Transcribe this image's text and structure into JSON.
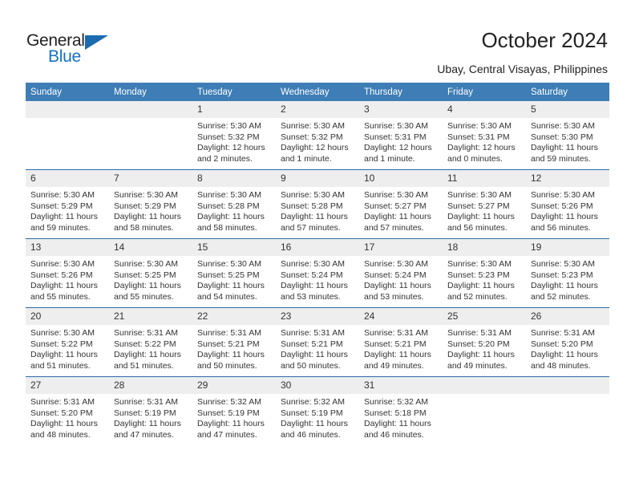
{
  "logo": {
    "word_one": "General",
    "word_two": "Blue",
    "triangle_color": "#1b6bb0",
    "blue_color": "#1472c4"
  },
  "header": {
    "title": "October 2024",
    "subtitle": "Ubay, Central Visayas, Philippines",
    "accent_color": "#3e7db5",
    "row_divider_color": "#2b6ca8",
    "daynum_band_color": "#eeeeee"
  },
  "calendar": {
    "weekday_headers": [
      "Sunday",
      "Monday",
      "Tuesday",
      "Wednesday",
      "Thursday",
      "Friday",
      "Saturday"
    ],
    "weeks": [
      [
        {
          "day": "",
          "sunrise": "",
          "sunset": "",
          "daylight": ""
        },
        {
          "day": "",
          "sunrise": "",
          "sunset": "",
          "daylight": ""
        },
        {
          "day": "1",
          "sunrise": "Sunrise: 5:30 AM",
          "sunset": "Sunset: 5:32 PM",
          "daylight": "Daylight: 12 hours and 2 minutes."
        },
        {
          "day": "2",
          "sunrise": "Sunrise: 5:30 AM",
          "sunset": "Sunset: 5:32 PM",
          "daylight": "Daylight: 12 hours and 1 minute."
        },
        {
          "day": "3",
          "sunrise": "Sunrise: 5:30 AM",
          "sunset": "Sunset: 5:31 PM",
          "daylight": "Daylight: 12 hours and 1 minute."
        },
        {
          "day": "4",
          "sunrise": "Sunrise: 5:30 AM",
          "sunset": "Sunset: 5:31 PM",
          "daylight": "Daylight: 12 hours and 0 minutes."
        },
        {
          "day": "5",
          "sunrise": "Sunrise: 5:30 AM",
          "sunset": "Sunset: 5:30 PM",
          "daylight": "Daylight: 11 hours and 59 minutes."
        }
      ],
      [
        {
          "day": "6",
          "sunrise": "Sunrise: 5:30 AM",
          "sunset": "Sunset: 5:29 PM",
          "daylight": "Daylight: 11 hours and 59 minutes."
        },
        {
          "day": "7",
          "sunrise": "Sunrise: 5:30 AM",
          "sunset": "Sunset: 5:29 PM",
          "daylight": "Daylight: 11 hours and 58 minutes."
        },
        {
          "day": "8",
          "sunrise": "Sunrise: 5:30 AM",
          "sunset": "Sunset: 5:28 PM",
          "daylight": "Daylight: 11 hours and 58 minutes."
        },
        {
          "day": "9",
          "sunrise": "Sunrise: 5:30 AM",
          "sunset": "Sunset: 5:28 PM",
          "daylight": "Daylight: 11 hours and 57 minutes."
        },
        {
          "day": "10",
          "sunrise": "Sunrise: 5:30 AM",
          "sunset": "Sunset: 5:27 PM",
          "daylight": "Daylight: 11 hours and 57 minutes."
        },
        {
          "day": "11",
          "sunrise": "Sunrise: 5:30 AM",
          "sunset": "Sunset: 5:27 PM",
          "daylight": "Daylight: 11 hours and 56 minutes."
        },
        {
          "day": "12",
          "sunrise": "Sunrise: 5:30 AM",
          "sunset": "Sunset: 5:26 PM",
          "daylight": "Daylight: 11 hours and 56 minutes."
        }
      ],
      [
        {
          "day": "13",
          "sunrise": "Sunrise: 5:30 AM",
          "sunset": "Sunset: 5:26 PM",
          "daylight": "Daylight: 11 hours and 55 minutes."
        },
        {
          "day": "14",
          "sunrise": "Sunrise: 5:30 AM",
          "sunset": "Sunset: 5:25 PM",
          "daylight": "Daylight: 11 hours and 55 minutes."
        },
        {
          "day": "15",
          "sunrise": "Sunrise: 5:30 AM",
          "sunset": "Sunset: 5:25 PM",
          "daylight": "Daylight: 11 hours and 54 minutes."
        },
        {
          "day": "16",
          "sunrise": "Sunrise: 5:30 AM",
          "sunset": "Sunset: 5:24 PM",
          "daylight": "Daylight: 11 hours and 53 minutes."
        },
        {
          "day": "17",
          "sunrise": "Sunrise: 5:30 AM",
          "sunset": "Sunset: 5:24 PM",
          "daylight": "Daylight: 11 hours and 53 minutes."
        },
        {
          "day": "18",
          "sunrise": "Sunrise: 5:30 AM",
          "sunset": "Sunset: 5:23 PM",
          "daylight": "Daylight: 11 hours and 52 minutes."
        },
        {
          "day": "19",
          "sunrise": "Sunrise: 5:30 AM",
          "sunset": "Sunset: 5:23 PM",
          "daylight": "Daylight: 11 hours and 52 minutes."
        }
      ],
      [
        {
          "day": "20",
          "sunrise": "Sunrise: 5:30 AM",
          "sunset": "Sunset: 5:22 PM",
          "daylight": "Daylight: 11 hours and 51 minutes."
        },
        {
          "day": "21",
          "sunrise": "Sunrise: 5:31 AM",
          "sunset": "Sunset: 5:22 PM",
          "daylight": "Daylight: 11 hours and 51 minutes."
        },
        {
          "day": "22",
          "sunrise": "Sunrise: 5:31 AM",
          "sunset": "Sunset: 5:21 PM",
          "daylight": "Daylight: 11 hours and 50 minutes."
        },
        {
          "day": "23",
          "sunrise": "Sunrise: 5:31 AM",
          "sunset": "Sunset: 5:21 PM",
          "daylight": "Daylight: 11 hours and 50 minutes."
        },
        {
          "day": "24",
          "sunrise": "Sunrise: 5:31 AM",
          "sunset": "Sunset: 5:21 PM",
          "daylight": "Daylight: 11 hours and 49 minutes."
        },
        {
          "day": "25",
          "sunrise": "Sunrise: 5:31 AM",
          "sunset": "Sunset: 5:20 PM",
          "daylight": "Daylight: 11 hours and 49 minutes."
        },
        {
          "day": "26",
          "sunrise": "Sunrise: 5:31 AM",
          "sunset": "Sunset: 5:20 PM",
          "daylight": "Daylight: 11 hours and 48 minutes."
        }
      ],
      [
        {
          "day": "27",
          "sunrise": "Sunrise: 5:31 AM",
          "sunset": "Sunset: 5:20 PM",
          "daylight": "Daylight: 11 hours and 48 minutes."
        },
        {
          "day": "28",
          "sunrise": "Sunrise: 5:31 AM",
          "sunset": "Sunset: 5:19 PM",
          "daylight": "Daylight: 11 hours and 47 minutes."
        },
        {
          "day": "29",
          "sunrise": "Sunrise: 5:32 AM",
          "sunset": "Sunset: 5:19 PM",
          "daylight": "Daylight: 11 hours and 47 minutes."
        },
        {
          "day": "30",
          "sunrise": "Sunrise: 5:32 AM",
          "sunset": "Sunset: 5:19 PM",
          "daylight": "Daylight: 11 hours and 46 minutes."
        },
        {
          "day": "31",
          "sunrise": "Sunrise: 5:32 AM",
          "sunset": "Sunset: 5:18 PM",
          "daylight": "Daylight: 11 hours and 46 minutes."
        },
        {
          "day": "",
          "sunrise": "",
          "sunset": "",
          "daylight": ""
        },
        {
          "day": "",
          "sunrise": "",
          "sunset": "",
          "daylight": ""
        }
      ]
    ]
  }
}
